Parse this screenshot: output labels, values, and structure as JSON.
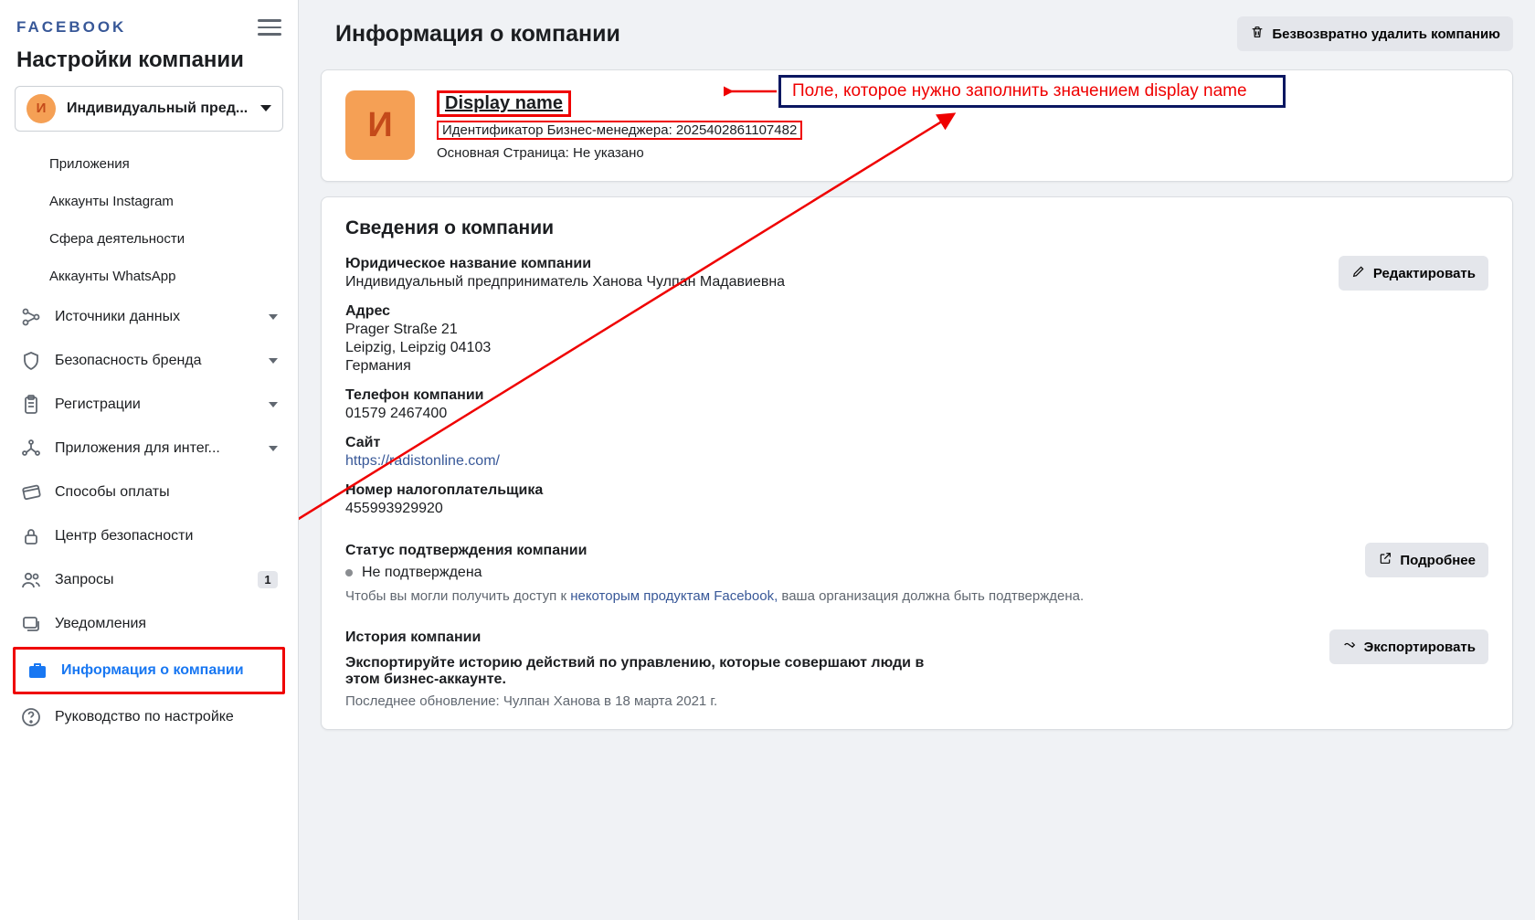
{
  "brand": "FACEBOOK",
  "sidebar_title": "Настройки компании",
  "business_selector": {
    "avatar_letter": "И",
    "label": "Индивидуальный пред..."
  },
  "nav": {
    "sub_items": [
      "Приложения",
      "Аккаунты Instagram",
      "Сфера деятельности",
      "Аккаунты WhatsApp"
    ],
    "data_sources": "Источники данных",
    "brand_safety": "Безопасность бренда",
    "registrations": "Регистрации",
    "integrations": "Приложения для интег...",
    "payment": "Способы оплаты",
    "security_center": "Центр безопасности",
    "requests": "Запросы",
    "requests_badge": "1",
    "notifications": "Уведомления",
    "company_info": "Информация о компании",
    "setup_guide": "Руководство по настройке"
  },
  "page": {
    "title": "Информация о компании",
    "delete_btn": "Безвозвратно удалить компанию"
  },
  "company_card": {
    "avatar_letter": "И",
    "display_name": "Display name",
    "id_label": "Идентификатор Бизнес-менеджера:",
    "id_value": "2025402861107482",
    "primary_page_label": "Основная Страница:",
    "primary_page_value": "Не указано"
  },
  "details": {
    "section_title": "Сведения о компании",
    "edit_btn": "Редактировать",
    "legal_name_label": "Юридическое название компании",
    "legal_name": "Индивидуальный предприниматель Ханова Чулпан Мадавиевна",
    "address_label": "Адрес",
    "address_line1": "Prager Straße 21",
    "address_line2": "Leipzig, Leipzig 04103",
    "address_line3": "Германия",
    "phone_label": "Телефон компании",
    "phone": "01579 2467400",
    "site_label": "Сайт",
    "site": "https://radistonline.com/",
    "tax_label": "Номер налогоплательщика",
    "tax": "455993929920"
  },
  "verification": {
    "title": "Статус подтверждения компании",
    "status": "Не подтверждена",
    "more_btn": "Подробнее",
    "hint_prefix": "Чтобы вы могли получить доступ к ",
    "hint_link": "некоторым продуктам Facebook,",
    "hint_suffix": " ваша организация должна быть подтверждена."
  },
  "history": {
    "title": "История компании",
    "export_btn": "Экспортировать",
    "bold_line": "Экспортируйте историю действий по управлению, которые совершают люди в этом бизнес-аккаунте.",
    "last_update": "Последнее обновление: Чулпан Ханова в 18 марта 2021 г."
  },
  "annotation": {
    "callout": "Поле, которое нужно заполнить значением display name"
  }
}
